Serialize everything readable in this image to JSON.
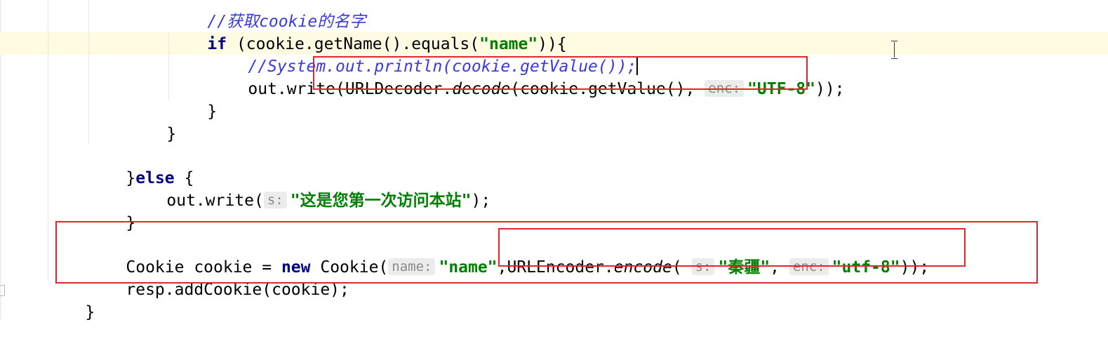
{
  "code": {
    "line_comment_cut": "//获取cookie的名字",
    "line_if": {
      "kw": "if",
      "pre": " (cookie.getName().equals(",
      "str": "\"name\"",
      "post": ")){"
    },
    "line_comment": "//System.out.println(cookie.getValue());",
    "line_write": {
      "pre": "out.write(",
      "cls": "URLDecoder.",
      "method": "decode",
      "args": "(cookie.getValue(),",
      "hint": "enc:",
      "str": "\"UTF-8\"",
      "post": "));"
    },
    "line_close_inner": "}",
    "line_close_for": "}",
    "line_else": {
      "brace": "}",
      "kw": "else",
      "post": " {"
    },
    "line_write2": {
      "pre": "out.write(",
      "hint": "s:",
      "str": "\"这是您第一次访问本站\"",
      "post": ");"
    },
    "line_close_else": "}",
    "line_cookie": {
      "pre": "Cookie cookie = ",
      "kw": "new",
      "mid": " Cookie(",
      "hint_name": "name:",
      "str_name": "\"name\"",
      "comma": ",",
      "cls": "URLEncoder.",
      "method": "encode",
      "paren": "(",
      "hint_s": "s:",
      "str_s": "\"秦疆\"",
      "comma2": ",",
      "hint_enc": "enc:",
      "str_enc": "\"utf-8\"",
      "post": "));"
    },
    "line_add": "resp.addCookie(cookie);",
    "line_close_method": "}"
  },
  "colors": {
    "keyword": "#000080",
    "string": "#008000",
    "comment": "#3a3ad9",
    "highlight_box": "#e2252b",
    "current_line": "#fffbe3"
  }
}
